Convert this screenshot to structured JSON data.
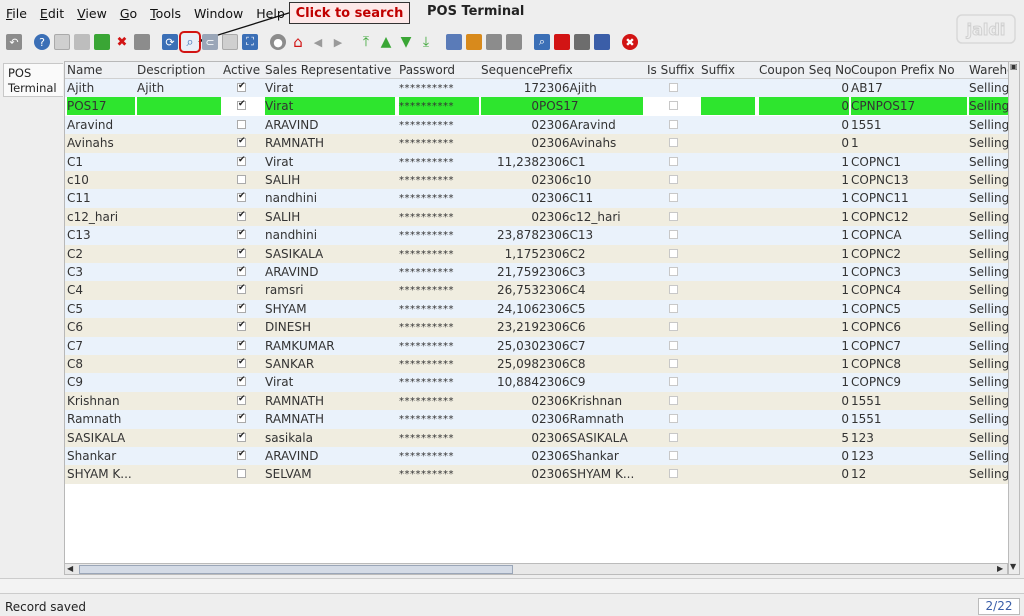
{
  "window": {
    "title": "POS Terminal"
  },
  "menu": [
    {
      "key": "F",
      "rest": "ile"
    },
    {
      "key": "E",
      "rest": "dit"
    },
    {
      "key": "V",
      "rest": "iew"
    },
    {
      "key": "G",
      "rest": "o"
    },
    {
      "key": "T",
      "rest": "ools"
    },
    {
      "key": "",
      "rest": "Window"
    },
    {
      "key": "",
      "rest": "Help"
    }
  ],
  "callout": {
    "text": "Click to search"
  },
  "logo": {
    "text": "jaldi"
  },
  "side_tab": {
    "line1": "POS",
    "line2": "Terminal"
  },
  "toolbar": {
    "icons": [
      "undo-icon",
      "help-icon",
      "new-record-icon",
      "copy-record-icon",
      "delete-selection-icon",
      "delete-icon",
      "save-icon",
      "refresh-icon",
      "find-icon",
      "attachment-icon",
      "chat-icon",
      "grid-toggle-icon",
      "history-icon",
      "home-icon",
      "previous-icon",
      "next-icon",
      "first-record-icon",
      "previous-record-icon",
      "next-record-icon",
      "last-record-icon",
      "report-icon",
      "archive-icon",
      "print-preview-icon",
      "print-icon",
      "zoom-across-icon",
      "workflow-icon",
      "process-icon",
      "product-info-icon",
      "end-icon"
    ],
    "colors": {
      "green": "#3aa635",
      "blue": "#3b6fb6",
      "red": "#d21414",
      "gray": "#8c8c8c",
      "orange": "#d88a1c"
    }
  },
  "grid": {
    "headers": [
      "Name",
      "Description",
      "Active",
      "Sales Representative",
      "Password",
      "Sequence",
      "Prefix",
      "Is Suffix",
      "Suffix",
      "Coupon Seq No",
      "Coupon Prefix No",
      "Wareho"
    ],
    "selected_color": "#2ee52e",
    "rows": [
      {
        "name": "Ajith",
        "description": "Ajith",
        "active": true,
        "sales_rep": "Virat",
        "password": "**********",
        "sequence": "17",
        "prefix": "2306Ajith",
        "is_suffix": false,
        "suffix": "",
        "coupon_seq": "0",
        "coupon_prefix": "AB17",
        "warehouse": "Selling"
      },
      {
        "name": "POS17",
        "description": "",
        "active": true,
        "sales_rep": "Virat",
        "password": "**********",
        "sequence": "0",
        "prefix": "POS17",
        "is_suffix": false,
        "suffix": "",
        "coupon_seq": "0",
        "coupon_prefix": "CPNPOS17",
        "warehouse": "Selling",
        "selected": true
      },
      {
        "name": "Aravind",
        "description": "",
        "active": false,
        "sales_rep": "ARAVIND",
        "password": "**********",
        "sequence": "0",
        "prefix": "2306Aravind",
        "is_suffix": false,
        "suffix": "",
        "coupon_seq": "0",
        "coupon_prefix": "1551",
        "warehouse": "Selling"
      },
      {
        "name": "Avinahs",
        "description": "",
        "active": true,
        "sales_rep": "RAMNATH",
        "password": "**********",
        "sequence": "0",
        "prefix": "2306Avinahs",
        "is_suffix": false,
        "suffix": "",
        "coupon_seq": "0",
        "coupon_prefix": "1",
        "warehouse": "Selling"
      },
      {
        "name": "C1",
        "description": "",
        "active": true,
        "sales_rep": "Virat",
        "password": "**********",
        "sequence": "11,238",
        "prefix": "2306C1",
        "is_suffix": false,
        "suffix": "",
        "coupon_seq": "1",
        "coupon_prefix": "COPNC1",
        "warehouse": "Selling"
      },
      {
        "name": "c10",
        "description": "",
        "active": false,
        "sales_rep": "SALIH",
        "password": "**********",
        "sequence": "0",
        "prefix": "2306c10",
        "is_suffix": false,
        "suffix": "",
        "coupon_seq": "1",
        "coupon_prefix": "COPNC13",
        "warehouse": "Selling"
      },
      {
        "name": "C11",
        "description": "",
        "active": true,
        "sales_rep": "nandhini",
        "password": "**********",
        "sequence": "0",
        "prefix": "2306C11",
        "is_suffix": false,
        "suffix": "",
        "coupon_seq": "1",
        "coupon_prefix": "COPNC11",
        "warehouse": "Selling"
      },
      {
        "name": "c12_hari",
        "description": "",
        "active": true,
        "sales_rep": "SALIH",
        "password": "**********",
        "sequence": "0",
        "prefix": "2306c12_hari",
        "is_suffix": false,
        "suffix": "",
        "coupon_seq": "1",
        "coupon_prefix": "COPNC12",
        "warehouse": "Selling"
      },
      {
        "name": "C13",
        "description": "",
        "active": true,
        "sales_rep": "nandhini",
        "password": "**********",
        "sequence": "23,878",
        "prefix": "2306C13",
        "is_suffix": false,
        "suffix": "",
        "coupon_seq": "1",
        "coupon_prefix": "COPNCA",
        "warehouse": "Selling"
      },
      {
        "name": "C2",
        "description": "",
        "active": true,
        "sales_rep": "SASIKALA",
        "password": "**********",
        "sequence": "1,175",
        "prefix": "2306C2",
        "is_suffix": false,
        "suffix": "",
        "coupon_seq": "1",
        "coupon_prefix": "COPNC2",
        "warehouse": "Selling"
      },
      {
        "name": "C3",
        "description": "",
        "active": true,
        "sales_rep": "ARAVIND",
        "password": "**********",
        "sequence": "21,759",
        "prefix": "2306C3",
        "is_suffix": false,
        "suffix": "",
        "coupon_seq": "1",
        "coupon_prefix": "COPNC3",
        "warehouse": "Selling"
      },
      {
        "name": "C4",
        "description": "",
        "active": true,
        "sales_rep": "ramsri",
        "password": "**********",
        "sequence": "26,753",
        "prefix": "2306C4",
        "is_suffix": false,
        "suffix": "",
        "coupon_seq": "1",
        "coupon_prefix": "COPNC4",
        "warehouse": "Selling"
      },
      {
        "name": "C5",
        "description": "",
        "active": true,
        "sales_rep": "SHYAM",
        "password": "**********",
        "sequence": "24,106",
        "prefix": "2306C5",
        "is_suffix": false,
        "suffix": "",
        "coupon_seq": "1",
        "coupon_prefix": "COPNC5",
        "warehouse": "Selling"
      },
      {
        "name": "C6",
        "description": "",
        "active": true,
        "sales_rep": "DINESH",
        "password": "**********",
        "sequence": "23,219",
        "prefix": "2306C6",
        "is_suffix": false,
        "suffix": "",
        "coupon_seq": "1",
        "coupon_prefix": "COPNC6",
        "warehouse": "Selling"
      },
      {
        "name": "C7",
        "description": "",
        "active": true,
        "sales_rep": "RAMKUMAR",
        "password": "**********",
        "sequence": "25,030",
        "prefix": "2306C7",
        "is_suffix": false,
        "suffix": "",
        "coupon_seq": "1",
        "coupon_prefix": "COPNC7",
        "warehouse": "Selling"
      },
      {
        "name": "C8",
        "description": "",
        "active": true,
        "sales_rep": "SANKAR",
        "password": "**********",
        "sequence": "25,098",
        "prefix": "2306C8",
        "is_suffix": false,
        "suffix": "",
        "coupon_seq": "1",
        "coupon_prefix": "COPNC8",
        "warehouse": "Selling"
      },
      {
        "name": "C9",
        "description": "",
        "active": true,
        "sales_rep": "Virat",
        "password": "**********",
        "sequence": "10,884",
        "prefix": "2306C9",
        "is_suffix": false,
        "suffix": "",
        "coupon_seq": "1",
        "coupon_prefix": "COPNC9",
        "warehouse": "Selling"
      },
      {
        "name": "Krishnan",
        "description": "",
        "active": true,
        "sales_rep": "RAMNATH",
        "password": "**********",
        "sequence": "0",
        "prefix": "2306Krishnan",
        "is_suffix": false,
        "suffix": "",
        "coupon_seq": "0",
        "coupon_prefix": "1551",
        "warehouse": "Selling"
      },
      {
        "name": "Ramnath",
        "description": "",
        "active": true,
        "sales_rep": "RAMNATH",
        "password": "**********",
        "sequence": "0",
        "prefix": "2306Ramnath",
        "is_suffix": false,
        "suffix": "",
        "coupon_seq": "0",
        "coupon_prefix": "1551",
        "warehouse": "Selling"
      },
      {
        "name": "SASIKALA",
        "description": "",
        "active": true,
        "sales_rep": "sasikala",
        "password": "**********",
        "sequence": "0",
        "prefix": "2306SASIKALA",
        "is_suffix": false,
        "suffix": "",
        "coupon_seq": "5",
        "coupon_prefix": "123",
        "warehouse": "Selling"
      },
      {
        "name": "Shankar",
        "description": "",
        "active": true,
        "sales_rep": "ARAVIND",
        "password": "**********",
        "sequence": "0",
        "prefix": "2306Shankar",
        "is_suffix": false,
        "suffix": "",
        "coupon_seq": "0",
        "coupon_prefix": "123",
        "warehouse": "Selling"
      },
      {
        "name": "SHYAM K...",
        "description": "",
        "active": false,
        "sales_rep": "SELVAM",
        "password": "**********",
        "sequence": "0",
        "prefix": "2306SHYAM K...",
        "is_suffix": false,
        "suffix": "",
        "coupon_seq": "0",
        "coupon_prefix": "12",
        "warehouse": "Selling"
      }
    ]
  },
  "status": {
    "message": "Record saved",
    "count": "2/22"
  }
}
